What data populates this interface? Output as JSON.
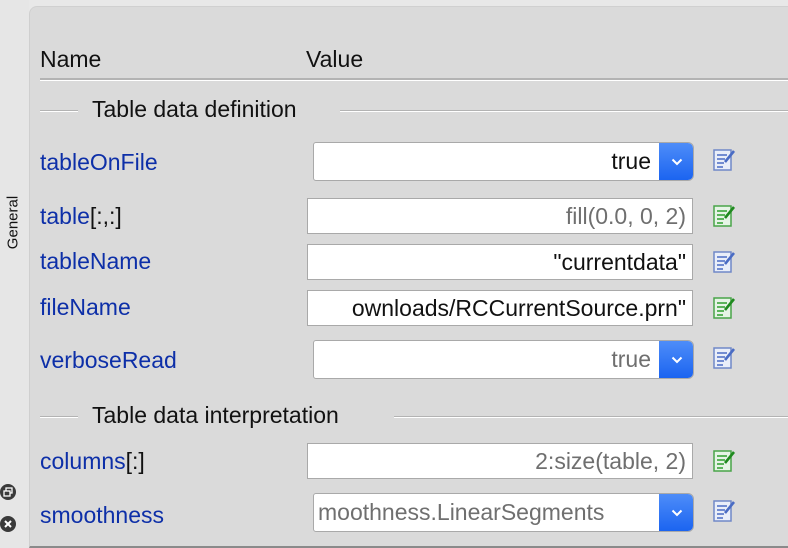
{
  "sidebar": {
    "tab_label": "General",
    "icons": [
      "restore-window-icon",
      "close-icon"
    ]
  },
  "header": {
    "name_label": "Name",
    "value_label": "Value"
  },
  "sections": [
    {
      "title": "Table data definition",
      "params": [
        {
          "name": "tableOnFile",
          "suffix": "",
          "kind": "combo",
          "value": "true",
          "value_style": "dark",
          "edit_icon_color": "blue"
        },
        {
          "name": "table",
          "suffix": "[:,:]",
          "kind": "field",
          "value": "fill(0.0, 0, 2)",
          "value_style": "grey",
          "edit_icon_color": "green"
        },
        {
          "name": "tableName",
          "suffix": "",
          "kind": "field",
          "value": "\"currentdata\"",
          "value_style": "dark",
          "edit_icon_color": "blue"
        },
        {
          "name": "fileName",
          "suffix": "",
          "kind": "field",
          "value": "ownloads/RCCurrentSource.prn\"",
          "value_style": "dark",
          "edit_icon_color": "green"
        },
        {
          "name": "verboseRead",
          "suffix": "",
          "kind": "combo",
          "value": "true",
          "value_style": "grey",
          "edit_icon_color": "blue"
        }
      ]
    },
    {
      "title": "Table data interpretation",
      "params": [
        {
          "name": "columns",
          "suffix": "[:]",
          "kind": "field",
          "value": "2:size(table, 2)",
          "value_style": "grey",
          "edit_icon_color": "green"
        },
        {
          "name": "smoothness",
          "suffix": "",
          "kind": "combo",
          "value": "moothness.LinearSegments",
          "value_style": "grey",
          "edit_icon_color": "blue"
        }
      ]
    }
  ],
  "colors": {
    "param_name": "#0d2fa8",
    "combo_button": "#1a63f0",
    "edit_icon_blue": "#4a6cc4",
    "edit_icon_green": "#2f9e2f",
    "panel_bg": "#dadada"
  }
}
